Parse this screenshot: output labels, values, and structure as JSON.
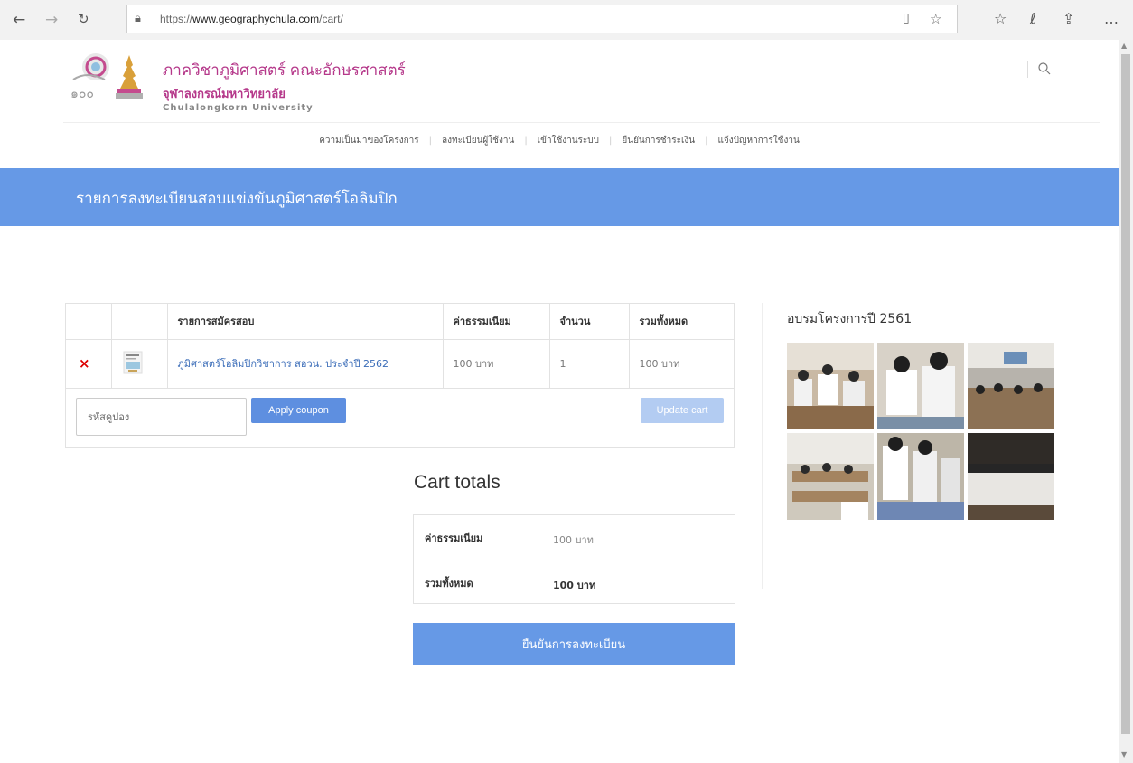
{
  "browser": {
    "url_prefix": "https://",
    "url_host": "www.geographychula.com",
    "url_path": "/cart/"
  },
  "header": {
    "logo_line1": "ภาควิชาภูมิศาสตร์ คณะอักษรศาสตร์",
    "logo_line2": "จุฬาลงกรณ์มหาวิทยาลัย",
    "logo_line3": "Chulalongkorn University"
  },
  "menu": {
    "items": [
      {
        "label": "ความเป็นมาของโครงการ"
      },
      {
        "label": "ลงทะเบียนผู้ใช้งาน"
      },
      {
        "label": "เข้าใช้งานระบบ"
      },
      {
        "label": "ยืนยันการชำระเงิน"
      },
      {
        "label": "แจ้งปัญหาการใช้งาน"
      }
    ]
  },
  "banner": {
    "title": "รายการลงทะเบียนสอบแข่งขันภูมิศาสตร์โอลิมปิก"
  },
  "cart": {
    "columns": {
      "product": "รายการสมัครสอบ",
      "price": "ค่าธรรมเนียม",
      "quantity": "จำนวน",
      "subtotal": "รวมทั้งหมด"
    },
    "rows": [
      {
        "remove": "×",
        "product": "ภูมิศาสตร์โอลิมปิกวิชาการ สอวน. ประจำปี 2562",
        "price": "100 บาท",
        "quantity": "1",
        "subtotal": "100 บาท"
      }
    ],
    "coupon_placeholder": "รหัสคูปอง",
    "apply_label": "Apply coupon",
    "update_label": "Update cart"
  },
  "totals": {
    "title": "Cart totals",
    "fee_label": "ค่าธรรมเนียม",
    "fee_value": "100 บาท",
    "total_label": "รวมทั้งหมด",
    "total_value": "100 บาท",
    "checkout_label": "ยืนยันการลงทะเบียน"
  },
  "sidebar": {
    "title": "อบรมโครงการปี 2561"
  },
  "colors": {
    "brand_blue": "#6699e6",
    "link_blue": "#3a6cb8",
    "logo_magenta": "#b5388a",
    "remove_red": "#dd0000"
  }
}
